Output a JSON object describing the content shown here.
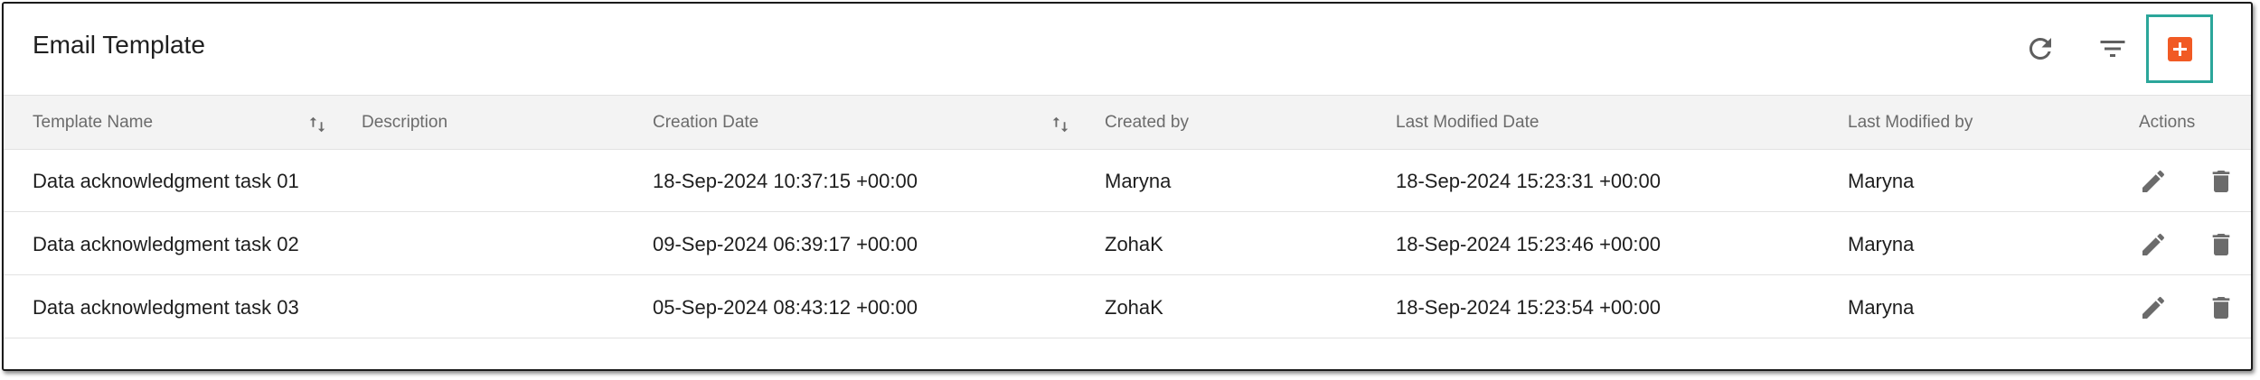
{
  "header": {
    "title": "Email Template"
  },
  "icons": {
    "refresh": "refresh-icon",
    "filter": "filter-icon",
    "add": "plus-icon",
    "sort": "sort-icon",
    "edit": "pencil-icon",
    "delete": "trash-icon"
  },
  "colors": {
    "accent": "#f15a24",
    "focus_ring": "#2ba69a",
    "icon_gray": "#6b6b6b"
  },
  "table": {
    "columns": {
      "name": "Template Name",
      "description": "Description",
      "creation_date": "Creation Date",
      "created_by": "Created by",
      "last_modified_date": "Last Modified Date",
      "last_modified_by": "Last Modified by",
      "actions": "Actions"
    },
    "rows": [
      {
        "name": "Data acknowledgment task 01",
        "description": "",
        "creation_date": "18-Sep-2024 10:37:15 +00:00",
        "created_by": "Maryna",
        "last_modified_date": "18-Sep-2024 15:23:31 +00:00",
        "last_modified_by": "Maryna"
      },
      {
        "name": "Data acknowledgment task 02",
        "description": "",
        "creation_date": "09-Sep-2024 06:39:17 +00:00",
        "created_by": "ZohaK",
        "last_modified_date": "18-Sep-2024 15:23:46 +00:00",
        "last_modified_by": "Maryna"
      },
      {
        "name": "Data acknowledgment task 03",
        "description": "",
        "creation_date": "05-Sep-2024 08:43:12 +00:00",
        "created_by": "ZohaK",
        "last_modified_date": "18-Sep-2024 15:23:54 +00:00",
        "last_modified_by": "Maryna"
      }
    ]
  }
}
